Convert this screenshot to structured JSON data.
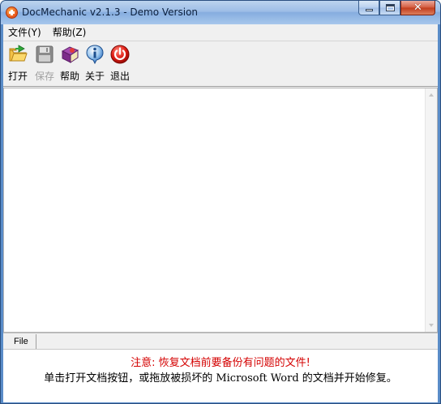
{
  "window": {
    "title": "DocMechanic v2.1.3 - Demo Version",
    "controls": [
      "minimize",
      "maximize",
      "close"
    ]
  },
  "menu": {
    "items": [
      {
        "label": "文件(Y)"
      },
      {
        "label": "帮助(Z)"
      }
    ]
  },
  "toolbar": {
    "buttons": [
      {
        "label": "打开",
        "icon": "open-folder-icon",
        "enabled": true
      },
      {
        "label": "保存",
        "icon": "save-disk-icon",
        "enabled": false
      },
      {
        "label": "帮助",
        "icon": "help-book-icon",
        "enabled": true
      },
      {
        "label": "关于",
        "icon": "info-icon",
        "enabled": true
      },
      {
        "label": "退出",
        "icon": "power-icon",
        "enabled": true
      }
    ]
  },
  "tabs": [
    {
      "label": "File"
    }
  ],
  "notice": {
    "warning": "注意: 恢复文档前要备份有问题的文件!",
    "instruction": "单击打开文档按钮，或拖放被损坏的 Microsoft Word 的文档并开始修复。",
    "warning_color": "#d40000"
  }
}
